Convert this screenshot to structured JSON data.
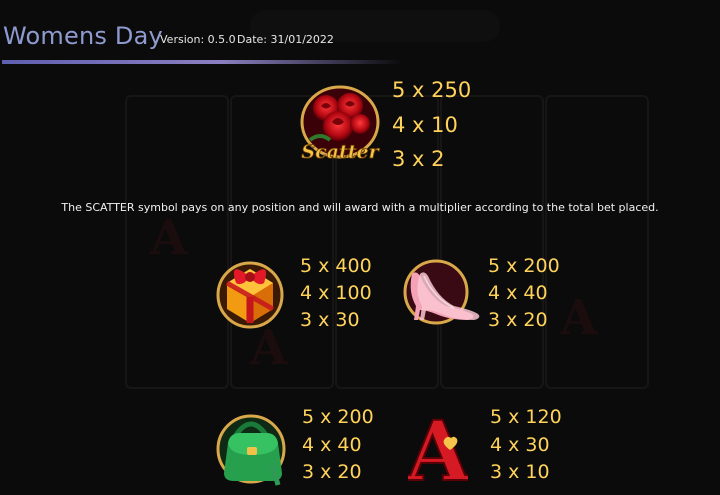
{
  "header": {
    "title": "Womens Day",
    "version": "Version: 0.5.0",
    "date": "Date: 31/01/2022"
  },
  "scatter": {
    "label": "Scatter",
    "pays": [
      "5 x 250",
      "4 x 10",
      "3 x 2"
    ],
    "description": "The SCATTER symbol pays on any position and will award with a multiplier according to the total bet placed."
  },
  "symbols": {
    "gift": {
      "pays": [
        "5 x 400",
        "4 x 100",
        "3 x 30"
      ]
    },
    "heels": {
      "pays": [
        "5 x 200",
        "4 x 40",
        "3 x 20"
      ]
    },
    "handbag": {
      "pays": [
        "5 x 200",
        "4 x 40",
        "3 x 20"
      ]
    },
    "ace": {
      "letter": "A",
      "pays": [
        "5 x 120",
        "4 x 30",
        "3 x 10"
      ]
    }
  },
  "colors": {
    "pay_text": "#ffd35a",
    "title": "#8f9bd0",
    "accent_line": "#6d6db8"
  }
}
